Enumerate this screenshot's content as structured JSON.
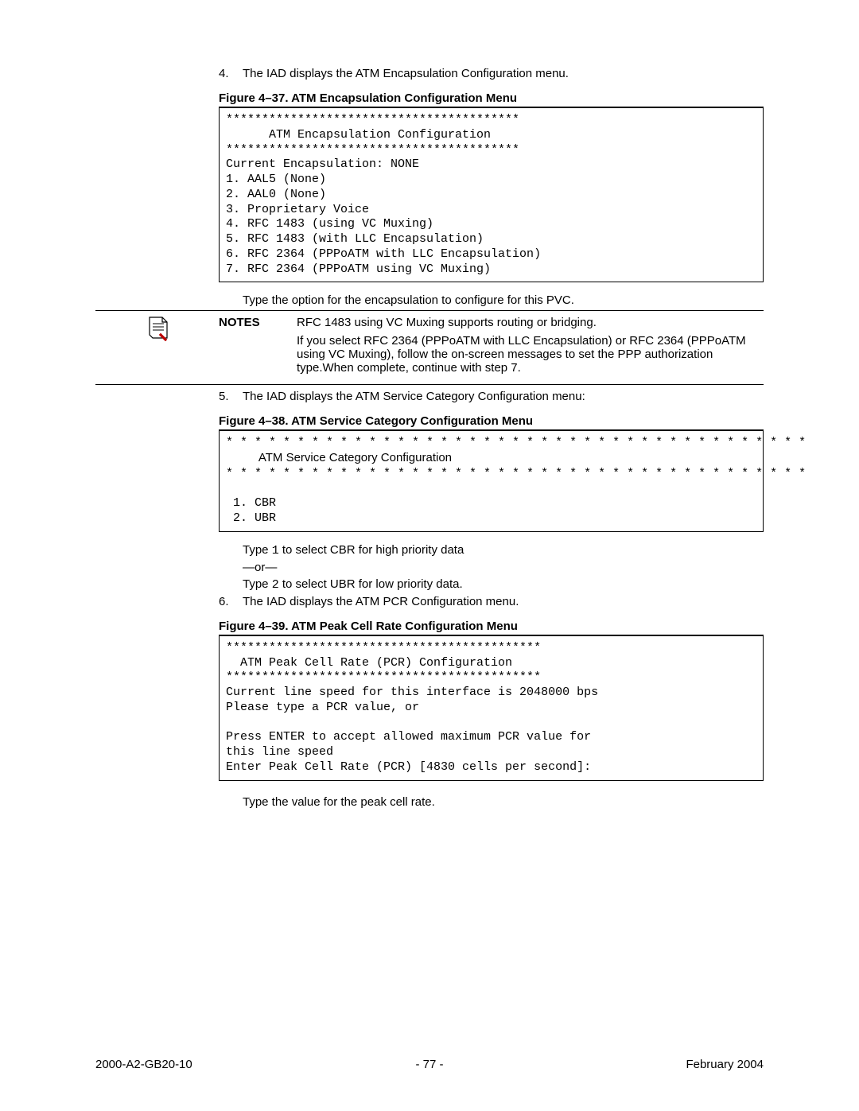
{
  "steps": {
    "s4_num": "4.",
    "s4_text": "The IAD displays the ATM Encapsulation Configuration menu.",
    "s5_num": "5.",
    "s5_text": "The IAD displays the ATM Service Category Configuration menu:",
    "s6_num": "6.",
    "s6_text": "The IAD displays the ATM PCR Configuration menu."
  },
  "fig37": {
    "caption": "Figure 4–37.  ATM Encapsulation Configuration Menu",
    "code": "*****************************************\n      ATM Encapsulation Configuration\n*****************************************\nCurrent Encapsulation: NONE\n1. AAL5 (None)\n2. AAL0 (None)\n3. Proprietary Voice\n4. RFC 1483 (using VC Muxing)\n5. RFC 1483 (with LLC Encapsulation)\n6. RFC 2364 (PPPoATM with LLC Encapsulation)\n7. RFC 2364 (PPPoATM using VC Muxing)"
  },
  "after37": "Type the option for the encapsulation to configure for this PVC.",
  "notes": {
    "label": "NOTES",
    "p1": "RFC 1483 using VC Muxing supports routing or bridging.",
    "p2": "If you select RFC 2364 (PPPoATM with LLC Encapsulation) or RFC 2364 (PPPoATM using VC Muxing), follow the on-screen messages to set the PPP authorization type.When complete, continue with step 7."
  },
  "fig38": {
    "caption": "Figure 4–38.  ATM Service Category Configuration Menu",
    "stars": "* * * * * * * * * * * * * * * * * * * * * * * * * * * * * * * * * * * * * * * * *",
    "title": "ATM Service Category Configuration",
    "opt1": " 1. CBR",
    "opt2": " 2. UBR"
  },
  "after38": {
    "l1a": "Type ",
    "l1code": "1",
    "l1b": " to select CBR for high priority data",
    "or": "—or—",
    "l2a": "Type ",
    "l2code": "2",
    "l2b": " to select UBR for low priority data."
  },
  "fig39": {
    "caption": "Figure 4–39.  ATM Peak Cell Rate Configuration Menu",
    "code": "********************************************\n  ATM Peak Cell Rate (PCR) Configuration\n********************************************\nCurrent line speed for this interface is 2048000 bps\nPlease type a PCR value, or\n\nPress ENTER to accept allowed maximum PCR value for\nthis line speed\nEnter Peak Cell Rate (PCR) [4830 cells per second]:"
  },
  "after39": "Type the value for the peak cell rate.",
  "footer": {
    "left": "2000-A2-GB20-10",
    "center": "- 77 -",
    "right": "February 2004"
  }
}
